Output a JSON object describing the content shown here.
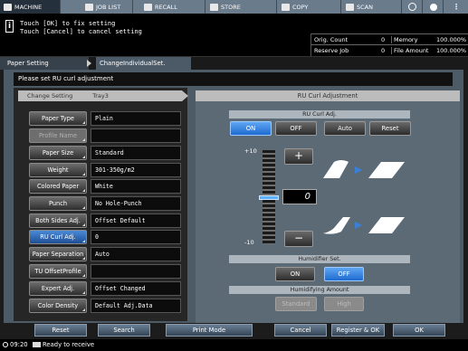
{
  "tabs": [
    {
      "label": "MACHINE",
      "icon": "machine-icon"
    },
    {
      "label": "JOB LIST",
      "icon": "job-list-icon"
    },
    {
      "label": "RECALL",
      "icon": "recall-icon"
    },
    {
      "label": "STORE",
      "icon": "store-icon"
    },
    {
      "label": "COPY",
      "icon": "copy-icon"
    },
    {
      "label": "SCAN",
      "icon": "scan-icon"
    }
  ],
  "message": {
    "line1": "Touch [OK] to fix setting",
    "line2": "Touch [Cancel] to cancel setting"
  },
  "status_box": {
    "orig_count_label": "Orig. Count",
    "orig_count": "0",
    "memory_label": "Memory",
    "memory": "100.000%",
    "reserve_job_label": "Reserve Job",
    "reserve_job": "0",
    "file_amount_label": "File Amount",
    "file_amount": "100.000%"
  },
  "breadcrumb": {
    "item1": "Paper Setting",
    "item2": "ChangeIndividualSet."
  },
  "instruction": "Please set RU curl adjustment",
  "left": {
    "header_label": "Change Setting",
    "header_tray": "Tray3",
    "rows": [
      {
        "label": "Paper Type",
        "value": "Plain"
      },
      {
        "label": "Profile Name",
        "value": ""
      },
      {
        "label": "Paper Size",
        "value": "Standard"
      },
      {
        "label": "Weight",
        "value": "301-350g/m2"
      },
      {
        "label": "Colored Paper",
        "value": "White"
      },
      {
        "label": "Punch",
        "value": "No Hole-Punch"
      },
      {
        "label": "Both Sides Adj.",
        "value": "Offset Default"
      },
      {
        "label": "RU Curl Adj.",
        "value": "0"
      },
      {
        "label": "Paper Separation",
        "value": "Auto"
      },
      {
        "label": "TU OffsetProfile",
        "value": ""
      },
      {
        "label": "Expert Adj.",
        "value": "Offset Changed"
      },
      {
        "label": "Color Density",
        "value": "Default Adj.Data"
      }
    ]
  },
  "right": {
    "header": "RU Curl Adjustment",
    "curl_sub": "RU Curl Adj.",
    "curl_buttons": [
      "ON",
      "OFF",
      "Auto",
      "Reset"
    ],
    "scale_max": "+10",
    "scale_min": "-10",
    "plus": "+",
    "minus": "−",
    "value": "0",
    "value_fraction": 0.5,
    "humid_sub": "Humidifier Set.",
    "humid_buttons": [
      "ON",
      "OFF"
    ],
    "amount_sub": "Humidifying Amount",
    "amount_buttons": [
      "Standard",
      "High"
    ]
  },
  "bottom": {
    "reset": "Reset",
    "search": "Search",
    "print_mode": "Print Mode",
    "cancel": "Cancel",
    "register_ok": "Register & OK",
    "ok": "OK"
  },
  "status": {
    "time": "09:20",
    "text": "Ready to receive"
  },
  "colors": {
    "accent_on": "#3a8ae6",
    "panel": "#4d5b67"
  }
}
